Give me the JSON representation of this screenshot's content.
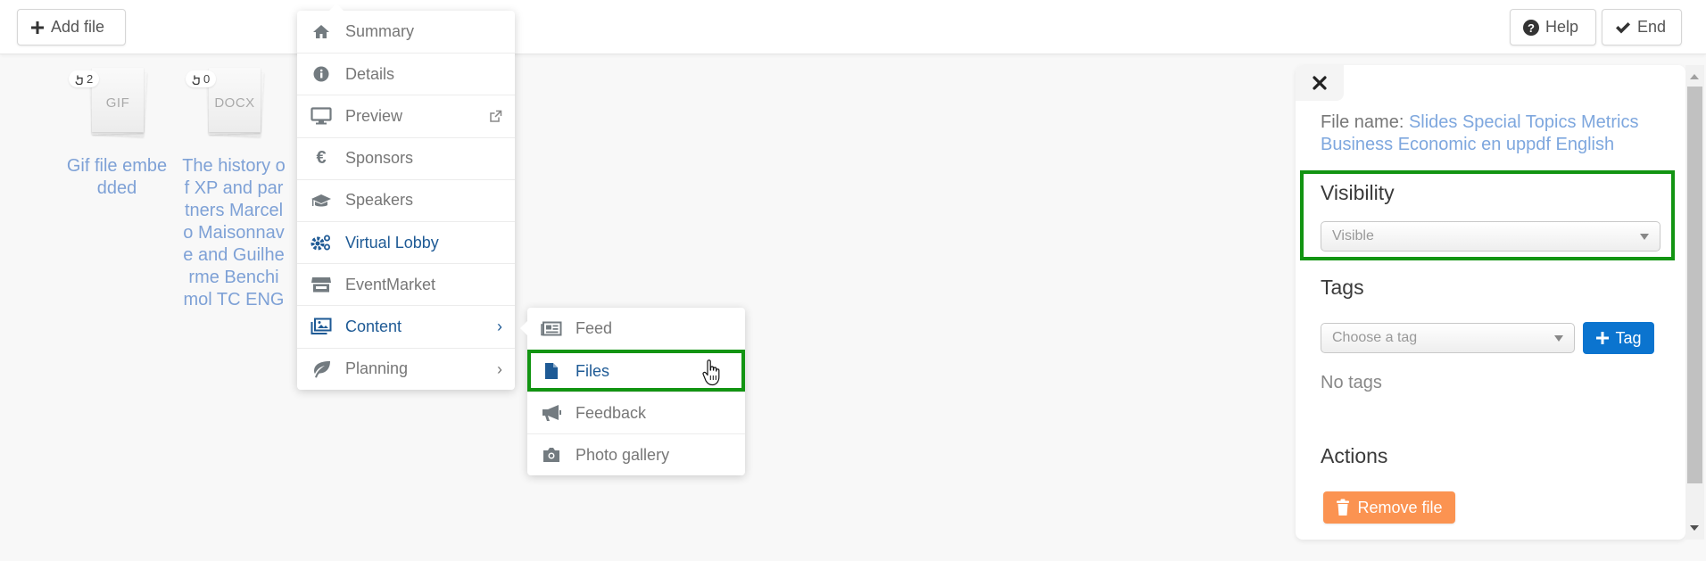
{
  "toolbar": {
    "add_file_label": "Add file",
    "help_label": "Help",
    "end_label": "End"
  },
  "files": [
    {
      "extension": "GIF",
      "views": "2",
      "name": "Gif file embedded"
    },
    {
      "extension": "DOCX",
      "views": "0",
      "name": "The history of XP and partners Marcelo Maisonnave and Guilherme Benchimol TC ENG"
    }
  ],
  "menu": {
    "items": [
      {
        "label": "Summary",
        "icon": "home-icon"
      },
      {
        "label": "Details",
        "icon": "info-circle-icon"
      },
      {
        "label": "Preview",
        "icon": "desktop-icon",
        "trailing": "external-link-icon"
      },
      {
        "label": "Sponsors",
        "icon": "euro-icon"
      },
      {
        "label": "Speakers",
        "icon": "graduation-cap-icon"
      },
      {
        "label": "Virtual Lobby",
        "icon": "cogs-icon",
        "active": true
      },
      {
        "label": "EventMarket",
        "icon": "store-icon"
      },
      {
        "label": "Content",
        "icon": "images-icon",
        "active": true,
        "has_submenu": true
      },
      {
        "label": "Planning",
        "icon": "leaf-icon",
        "has_submenu": true
      }
    ]
  },
  "submenu": {
    "items": [
      {
        "label": "Feed",
        "icon": "newspaper-icon"
      },
      {
        "label": "Files",
        "icon": "file-icon",
        "active": true,
        "highlighted": true
      },
      {
        "label": "Feedback",
        "icon": "bullhorn-icon"
      },
      {
        "label": "Photo gallery",
        "icon": "camera-icon"
      }
    ]
  },
  "panel": {
    "file_name_label": "File name:",
    "file_name_value": "Slides Special Topics Metrics Business Economic en uppdf English",
    "visibility_heading": "Visibility",
    "visibility_value": "Visible",
    "tags_heading": "Tags",
    "tag_placeholder": "Choose a tag",
    "add_tag_label": "Tag",
    "no_tags_text": "No tags",
    "actions_heading": "Actions",
    "remove_file_label": "Remove file"
  },
  "colors": {
    "accent_blue": "#1e5a95",
    "link_blue": "#7ea7de",
    "primary_button": "#0b74cf",
    "danger_button": "#fb9351",
    "highlight_green": "#129412"
  }
}
